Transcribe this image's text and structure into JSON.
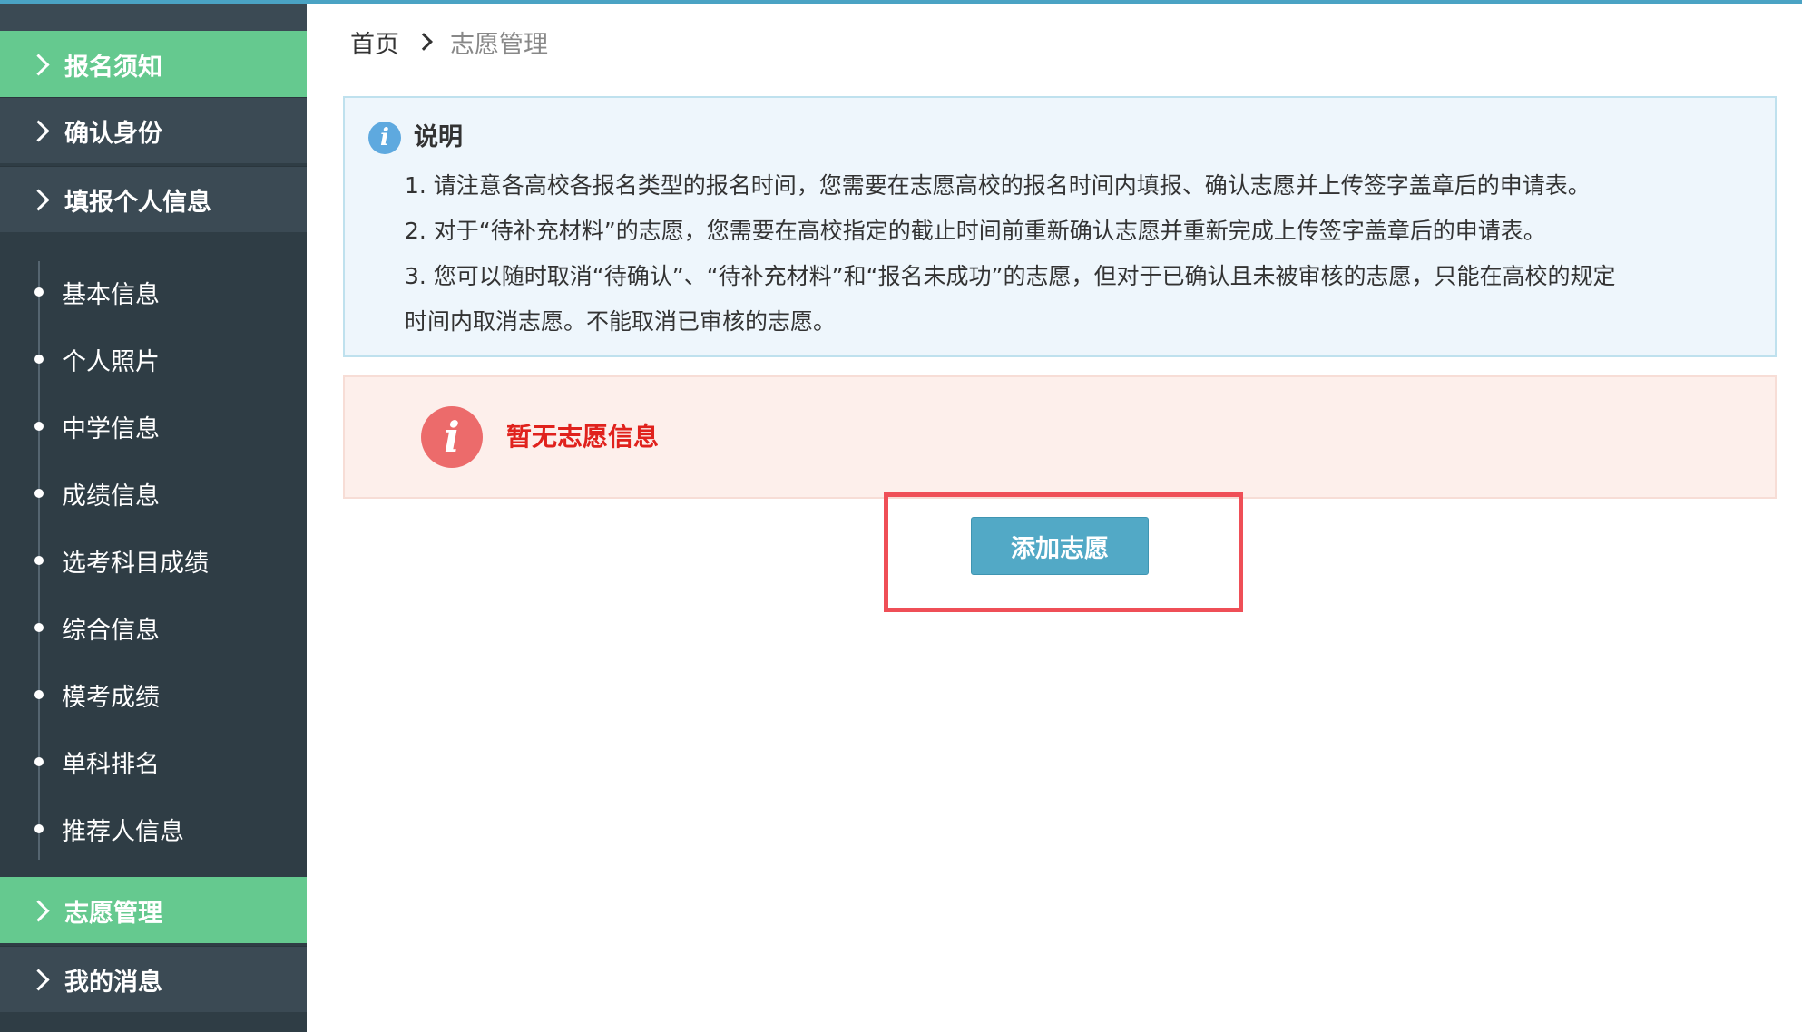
{
  "sidebar": {
    "sections": [
      {
        "label": "报名须知",
        "active": true
      },
      {
        "label": "确认身份",
        "active": false
      },
      {
        "label": "填报个人信息",
        "active": false
      }
    ],
    "sub_items": [
      {
        "label": "基本信息"
      },
      {
        "label": "个人照片"
      },
      {
        "label": "中学信息"
      },
      {
        "label": "成绩信息"
      },
      {
        "label": "选考科目成绩"
      },
      {
        "label": "综合信息"
      },
      {
        "label": "模考成绩"
      },
      {
        "label": "单科排名"
      },
      {
        "label": "推荐人信息"
      }
    ],
    "bottom_sections": [
      {
        "label": "志愿管理",
        "active": true
      },
      {
        "label": "我的消息",
        "active": false
      }
    ]
  },
  "breadcrumb": {
    "home": "首页",
    "current": "志愿管理"
  },
  "info": {
    "title": "说明",
    "icon": "info-icon",
    "lines": [
      "1. 请注意各高校各报名类型的报名时间，您需要在志愿高校的报名时间内填报、确认志愿并上传签字盖章后的申请表。",
      "2. 对于“待补充材料”的志愿，您需要在高校指定的截止时间前重新确认志愿并重新完成上传签字盖章后的申请表。",
      "3. 您可以随时取消“待确认”、“待补充材料”和“报名未成功”的志愿，但对于已确认且未被审核的志愿，只能在高校的规定",
      "时间内取消志愿。不能取消已审核的志愿。"
    ]
  },
  "alert": {
    "text": "暂无志愿信息",
    "icon": "alert-icon"
  },
  "actions": {
    "add_label": "添加志愿"
  },
  "colors": {
    "sidebar_bg": "#2f3d45",
    "sidebar_section": "#3b4a54",
    "active_green": "#65c98f",
    "button_blue": "#52a9c6",
    "alert_red": "#e0221d",
    "highlight_red": "#ef4f57"
  }
}
